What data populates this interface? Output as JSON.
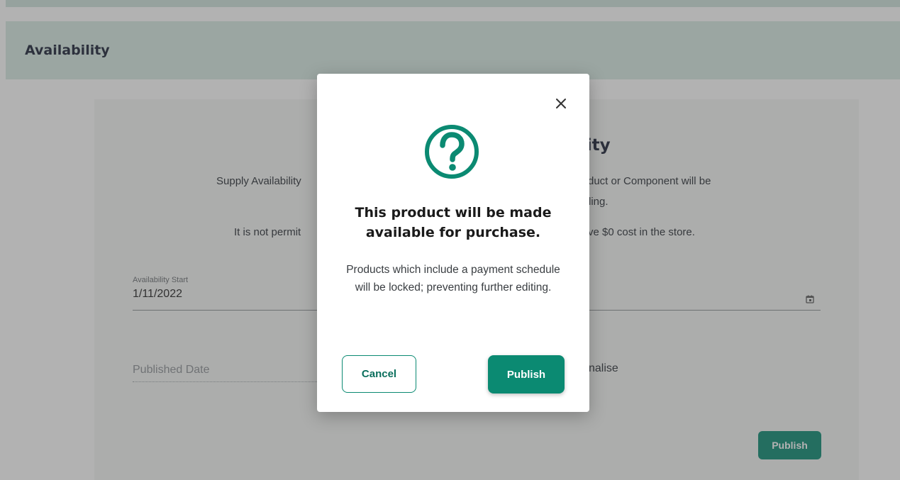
{
  "section": {
    "title": "Availability"
  },
  "card": {
    "heading_visible": "ility",
    "line1_left": "Supply Availability",
    "line1_right": "duct or Component will be",
    "line2_right": "ling.",
    "line3_left": "It is not permit",
    "line3_right": "ve $0 cost in the store.",
    "availability_start": {
      "label": "Availability Start",
      "value": "1/11/2022"
    },
    "published_date": {
      "placeholder": "Published Date"
    },
    "finalise_fragment": "nalise",
    "publish_label": "Publish"
  },
  "modal": {
    "title": "This product will be made available for purchase.",
    "body": "Products which include a payment schedule will be locked; preventing further editing.",
    "cancel_label": "Cancel",
    "publish_label": "Publish",
    "close_icon": "close-icon",
    "question_icon": "question-circle-icon"
  },
  "colors": {
    "accent": "#0b8a72",
    "header_bg": "#d7ebe4",
    "text_dark": "#1a2236"
  }
}
